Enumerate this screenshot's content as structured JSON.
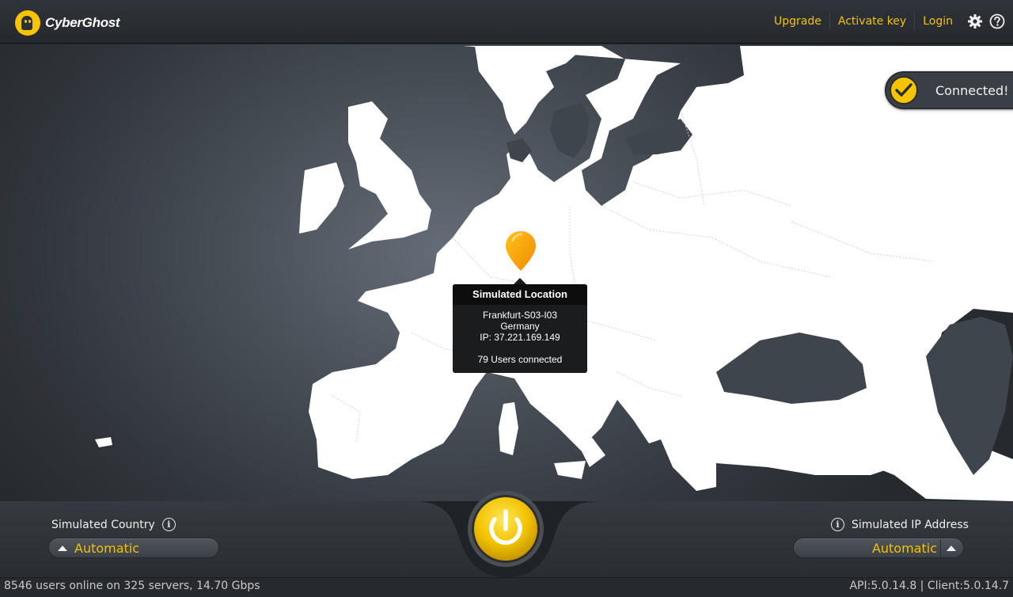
{
  "app": {
    "name": "CyberGhost"
  },
  "nav": {
    "upgrade": "Upgrade",
    "activate_key": "Activate key",
    "login": "Login"
  },
  "connection": {
    "status_text": "Connected!"
  },
  "location_tooltip": {
    "title": "Simulated Location",
    "server": "Frankfurt-S03-I03",
    "country": "Germany",
    "ip": "IP: 37.221.169.149",
    "users": "79 Users connected"
  },
  "simulated_country": {
    "label": "Simulated Country",
    "value": "Automatic"
  },
  "simulated_ip": {
    "label": "Simulated IP Address",
    "value": "Automatic"
  },
  "status_bar": {
    "left": "8546 users online on 325 servers, 14.70 Gbps",
    "right": "API:5.0.14.8 | Client:5.0.14.7"
  },
  "colors": {
    "accent": "#f7c400",
    "link": "#f2c200",
    "land": "#ffffff",
    "sea": "#4a5159"
  },
  "icons": {
    "settings": "gear-icon",
    "help": "help-icon",
    "info": "info-icon",
    "power": "power-icon",
    "check": "check-icon",
    "pin": "map-pin-icon"
  }
}
